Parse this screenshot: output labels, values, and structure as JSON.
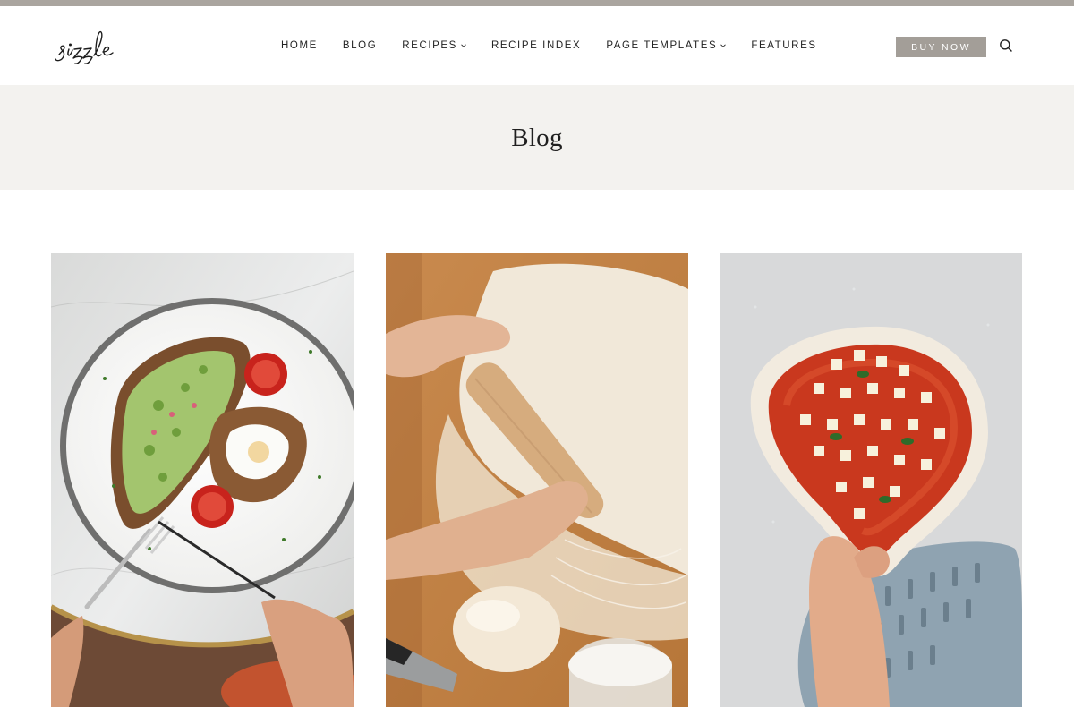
{
  "site": {
    "logo_text": "sizzle"
  },
  "nav": {
    "items": [
      {
        "label": "HOME",
        "has_dropdown": false
      },
      {
        "label": "BLOG",
        "has_dropdown": false
      },
      {
        "label": "RECIPES",
        "has_dropdown": true
      },
      {
        "label": "RECIPE INDEX",
        "has_dropdown": false
      },
      {
        "label": "PAGE TEMPLATES",
        "has_dropdown": true
      },
      {
        "label": "FEATURES",
        "has_dropdown": false
      }
    ],
    "buy_label": "BUY NOW",
    "search_icon": "search-icon"
  },
  "hero": {
    "title": "Blog"
  },
  "posts": [
    {
      "image": "avocado-toast-poached-egg"
    },
    {
      "image": "rolling-dough"
    },
    {
      "image": "pizza-dough-with-toppings"
    }
  ],
  "colors": {
    "top_strip": "#aaa59f",
    "hero_bg": "#f3f2ef",
    "button_bg": "#a39e98",
    "text": "#222222"
  }
}
